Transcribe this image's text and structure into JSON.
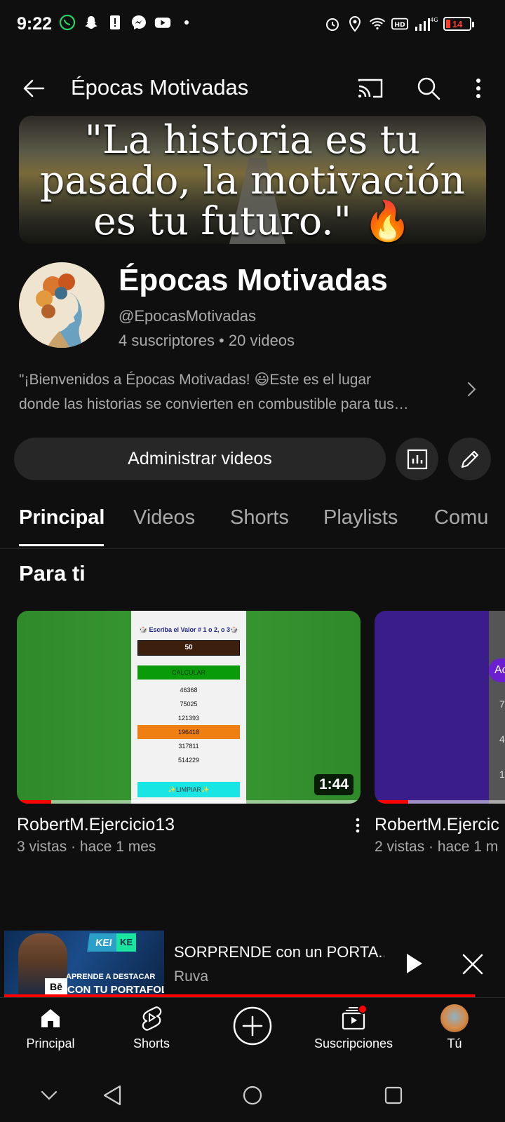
{
  "status_bar": {
    "time": "9:22",
    "network": "4G",
    "battery": "14",
    "icons": [
      "whatsapp-icon",
      "snapchat-icon",
      "alert-icon",
      "messenger-icon",
      "youtube-icon",
      "dot-icon",
      "alarm-icon",
      "location-icon",
      "wifi-icon",
      "hd-icon",
      "signal-icon",
      "battery-icon"
    ]
  },
  "header": {
    "title": "Épocas Motivadas",
    "icons": [
      "back-arrow-icon",
      "cast-icon",
      "search-icon",
      "more-vertical-icon"
    ]
  },
  "banner": {
    "lines": [
      "\"La historia es tu",
      "pasado, la motivación",
      "es tu futuro.\" 🔥"
    ]
  },
  "channel": {
    "name": "Épocas Motivadas",
    "handle": "@EpocasMotivadas",
    "stats": "4 suscriptores • 20 videos",
    "description_line1": "\"¡Bienvenidos a Épocas Motivadas! 😃Este es el lugar",
    "description_line2": "donde las historias se convierten en combustible para tus…"
  },
  "actions": {
    "manage_label": "Administrar videos",
    "icons": [
      "analytics-icon",
      "edit-pencil-icon"
    ]
  },
  "tabs": [
    "Principal",
    "Videos",
    "Shorts",
    "Playlists",
    "Comu"
  ],
  "section": {
    "title": "Para ti"
  },
  "videos": [
    {
      "title": "RobertM.Ejercicio13",
      "meta": "3 vistas · hace 1 mes",
      "duration": "1:44",
      "progress": 0.1,
      "screen": {
        "title": "🎲 Escriba el Valor # 1 o 2, o 3🎲",
        "input": "50",
        "calc": "CALCULAR",
        "rows": [
          "46368",
          "75025",
          "121393",
          "196418",
          "317811",
          "514229"
        ],
        "highlight_index": 3,
        "clear": "✨LIMPIAR✨"
      }
    },
    {
      "title": "RobertM.Ejercic",
      "meta": "2 vistas · hace 1 m",
      "progress": 0.1,
      "pill": "Ac",
      "digits": [
        "7",
        "4",
        "1"
      ]
    }
  ],
  "mini_player": {
    "title": "SORPRENDE con un PORTA..",
    "channel": "Ruva",
    "thumb_text": {
      "kei": "KEI",
      "kei2": "KE",
      "line1": "APRENDE A DESTACAR",
      "line2": "CON TU PORTAFOLIO",
      "be": "Bē"
    },
    "progress": 0.94
  },
  "bottom_nav": [
    {
      "label": "Principal",
      "icon": "home-icon"
    },
    {
      "label": "Shorts",
      "icon": "shorts-icon"
    },
    {
      "label": "",
      "icon": "create-plus-icon"
    },
    {
      "label": "Suscripciones",
      "icon": "subscriptions-icon"
    },
    {
      "label": "Tú",
      "icon": "avatar-icon"
    }
  ],
  "system_nav": [
    "collapse-chevron-icon",
    "back-triangle-icon",
    "home-circle-icon",
    "recents-square-icon"
  ],
  "colors": {
    "background": "#0f0f0f",
    "surface": "#272727",
    "accent_red": "#ff0000",
    "secondary_text": "#aaaaaa"
  }
}
